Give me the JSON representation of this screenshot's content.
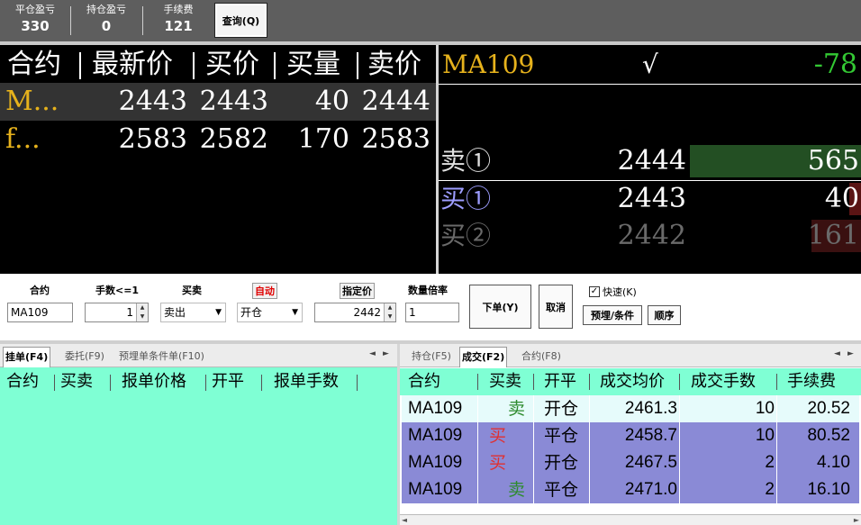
{
  "topbar": {
    "stats": [
      {
        "label": "平仓盈亏",
        "value": "330"
      },
      {
        "label": "持仓盈亏",
        "value": "0"
      },
      {
        "label": "手续费",
        "value": "121"
      }
    ],
    "query_label": "查询(Q)"
  },
  "quotes": {
    "headers": [
      "合约",
      "最新价",
      "买价",
      "买量",
      "卖价"
    ],
    "rows": [
      {
        "name": "M...",
        "last": "2443",
        "bid": "2443",
        "bid_vol": "40",
        "ask": "2444",
        "selected": true
      },
      {
        "name": "f...",
        "last": "2583",
        "bid": "2582",
        "bid_vol": "170",
        "ask": "2583",
        "selected": false
      }
    ]
  },
  "depth": {
    "symbol": "MA109",
    "check": "√",
    "change": "-78",
    "levels": [
      {
        "label": "卖①",
        "price": "2444",
        "qty": "565",
        "label_color": "#e0e0e0",
        "price_color": "#ffffff",
        "qty_color": "#ffffff",
        "bar_color": "#234f23",
        "bar_fraction": 1.0
      },
      {
        "label": "买①",
        "price": "2443",
        "qty": "40",
        "label_color": "#9d9dff",
        "price_color": "#ffffff",
        "qty_color": "#ffffff",
        "bar_color": "#5a1414",
        "bar_fraction": 0.07
      },
      {
        "label": "买②",
        "price": "2442",
        "qty": "161",
        "label_color": "#6a6a6a",
        "price_color": "#6a6a6a",
        "qty_color": "#6a6a6a",
        "bar_color": "#3a1010",
        "bar_fraction": 0.29
      }
    ]
  },
  "order": {
    "contract_label": "合约",
    "contract_value": "MA109",
    "lots_label": "手数<=1",
    "lots_value": "1",
    "side_label": "买卖",
    "side_value": "卖出",
    "offset_label": "自动",
    "offset_value": "开仓",
    "price_label": "指定价",
    "price_value": "2442",
    "multiplier_label": "数量倍率",
    "multiplier_value": "1",
    "place_label": "下单(Y)",
    "cancel_label": "取消",
    "fast_label": "快速(K)",
    "fast_checked": "✓",
    "condition_label": "预埋/条件",
    "sequence_label": "顺序"
  },
  "left_panel": {
    "tabs": [
      "挂单(F4)",
      "委托(F9)",
      "预埋单条件单(F10)"
    ],
    "headers": [
      "合约",
      "买卖",
      "报单价格",
      "开平",
      "报单手数"
    ]
  },
  "right_panel": {
    "tabs": [
      "持仓(F5)",
      "成交(F2)",
      "合约(F8)"
    ],
    "headers": [
      "合约",
      "买卖",
      "开平",
      "成交均价",
      "成交手数",
      "手续费"
    ],
    "rows": [
      {
        "contract": "MA109",
        "side": "卖",
        "offset": "开仓",
        "avg_price": "2461.3",
        "qty": "10",
        "fee": "20.52",
        "side_color": "#2e8b2e",
        "bg": "#e6fbfb"
      },
      {
        "contract": "MA109",
        "side": "买",
        "offset": "平仓",
        "avg_price": "2458.7",
        "qty": "10",
        "fee": "80.52",
        "side_color": "#e03030",
        "bg": "#8a8ad6"
      },
      {
        "contract": "MA109",
        "side": "买",
        "offset": "开仓",
        "avg_price": "2467.5",
        "qty": "2",
        "fee": "4.10",
        "side_color": "#e03030",
        "bg": "#8a8ad6"
      },
      {
        "contract": "MA109",
        "side": "卖",
        "offset": "平仓",
        "avg_price": "2471.0",
        "qty": "2",
        "fee": "16.10",
        "side_color": "#2e8b2e",
        "bg": "#8a8ad6"
      }
    ]
  },
  "icons": {
    "scroll_left": "◄",
    "scroll_right": "►",
    "spin_up": "▲",
    "spin_down": "▼",
    "dropdown": "▼",
    "tab_prev": "◄",
    "tab_next": "►"
  }
}
